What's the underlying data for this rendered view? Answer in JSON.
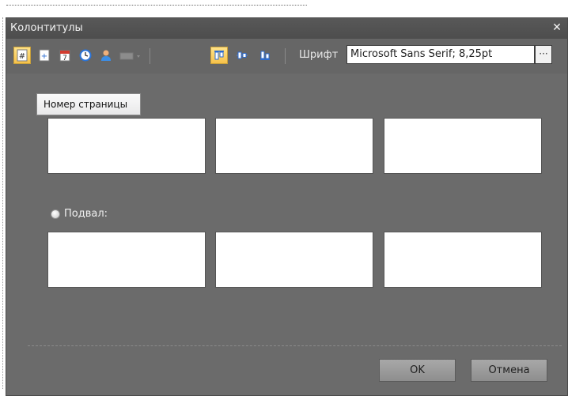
{
  "dialog": {
    "title": "Колонтитулы",
    "close_symbol": "✕"
  },
  "toolbar": {
    "buttons": [
      {
        "name": "page-number-icon",
        "glyph": "#"
      },
      {
        "name": "page-count-icon",
        "glyph": "+"
      },
      {
        "name": "date-icon",
        "glyph": "7"
      },
      {
        "name": "time-icon",
        "glyph": "◴"
      },
      {
        "name": "user-icon",
        "glyph": "●"
      },
      {
        "name": "image-dropdown-icon",
        "glyph": "▬"
      },
      {
        "name": "align-top-icon",
        "glyph": "▯"
      },
      {
        "name": "align-center-icon",
        "glyph": "▯"
      },
      {
        "name": "align-bottom-icon",
        "glyph": "▯"
      }
    ],
    "font_label": "Шрифт",
    "font_value": "Microsoft Sans Serif; 8,25pt",
    "font_button": "···"
  },
  "tooltip": {
    "text": "Номер страницы"
  },
  "footer_section": {
    "label": "Подвал:"
  },
  "actions": {
    "ok_label": "OK",
    "cancel_label": "Отмена"
  },
  "colors": {
    "dialog_bg": "#6b6b6b",
    "titlebar": "#525252",
    "selected_button": "#f7c24a"
  }
}
